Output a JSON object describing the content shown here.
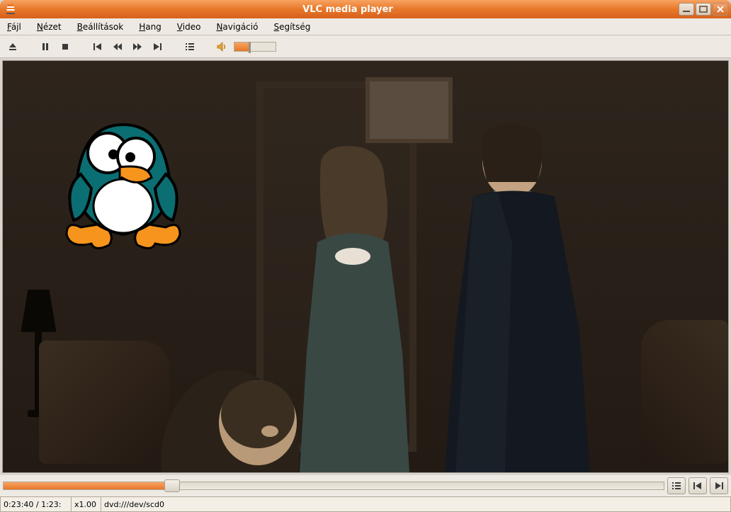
{
  "window": {
    "title": "VLC media player",
    "minimize_tooltip": "Minimize",
    "maximize_tooltip": "Maximize",
    "close_tooltip": "Close"
  },
  "menu": {
    "file": "Fájl",
    "view": "Nézet",
    "settings": "Beállítások",
    "audio": "Hang",
    "video": "Video",
    "navigation": "Navigáció",
    "help": "Segítség"
  },
  "toolbar": {
    "eject": "Eject",
    "pause": "Pause",
    "stop": "Stop",
    "prev": "Previous",
    "rewind": "Rewind",
    "forward": "Fast forward",
    "next": "Next",
    "playlist": "Show playlist",
    "mute": "Mute",
    "volume_percent": 35
  },
  "seek": {
    "position_percent": 25.5,
    "playlist_btn": "Playlist",
    "prev_btn": "Previous",
    "next_btn": "Next"
  },
  "status": {
    "time": "0:23:40 / 1:23:",
    "speed": "x1.00",
    "source": "dvd:///dev/scd0"
  }
}
